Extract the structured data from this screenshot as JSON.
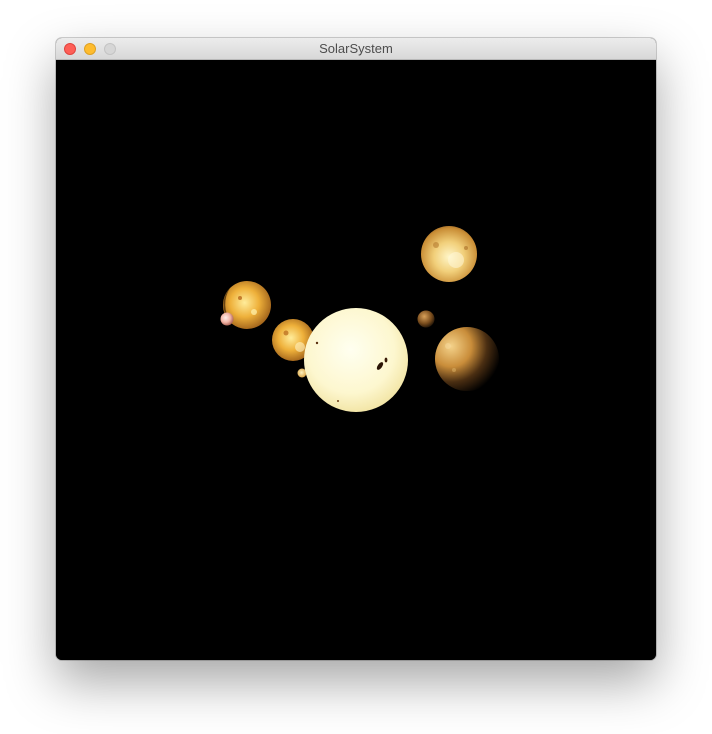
{
  "window": {
    "title": "SolarSystem",
    "controls": [
      "close",
      "minimize",
      "zoom"
    ]
  },
  "scene": {
    "background": "#000000",
    "bodies": [
      {
        "name": "sun",
        "color": "#fdf8d2"
      },
      {
        "name": "planet-upper-right",
        "color": "#e8b04a"
      },
      {
        "name": "planet-left",
        "color": "#e8a23a"
      },
      {
        "name": "moon-left-pink",
        "color": "#f0b2a8"
      },
      {
        "name": "planet-near-sun",
        "color": "#e8b04a"
      },
      {
        "name": "small-moon-near-sun",
        "color": "#f6d27a"
      },
      {
        "name": "small-planet-right",
        "color": "#b07a3a"
      },
      {
        "name": "planet-right-shaded",
        "color": "#d7913a"
      }
    ]
  }
}
